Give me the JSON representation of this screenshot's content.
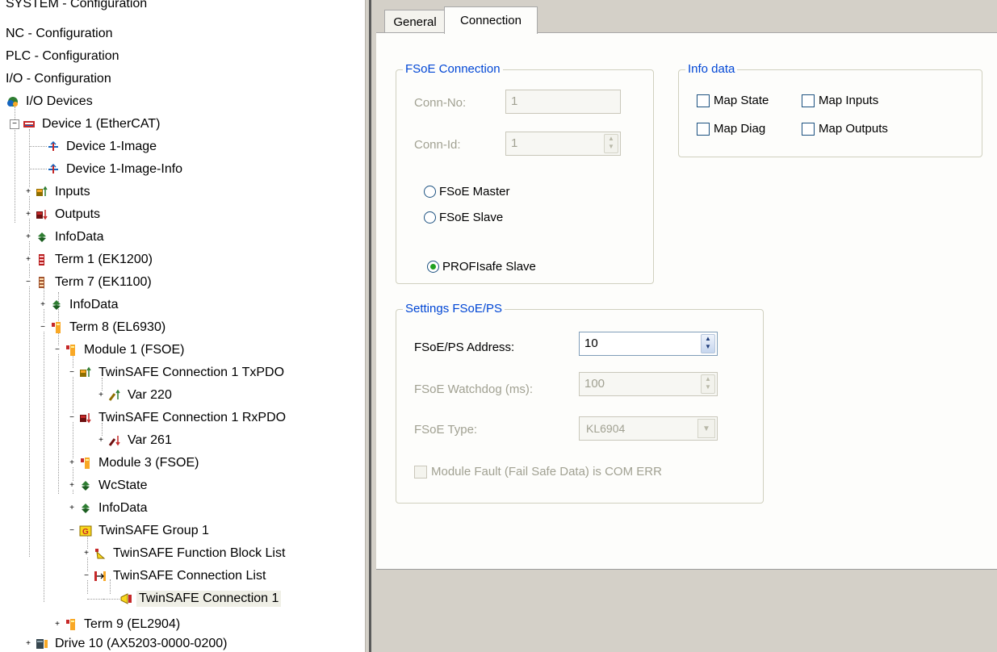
{
  "tree": {
    "nodes": [
      {
        "label": "SYSTEM - Configuration",
        "icon": "config-icon"
      },
      {
        "label": "NC - Configuration",
        "icon": ""
      },
      {
        "label": "PLC - Configuration",
        "icon": ""
      },
      {
        "label": "I/O - Configuration",
        "icon": ""
      },
      {
        "label": "I/O Devices",
        "icon": "io-devices-icon"
      },
      {
        "label": "Device 1 (EtherCAT)",
        "icon": "ethercat-device-icon"
      },
      {
        "label": "Device 1-Image",
        "icon": "image-icon"
      },
      {
        "label": "Device 1-Image-Info",
        "icon": "image-info-icon"
      },
      {
        "label": "Inputs",
        "icon": "inputs-icon"
      },
      {
        "label": "Outputs",
        "icon": "outputs-icon"
      },
      {
        "label": "InfoData",
        "icon": "infodata-icon"
      },
      {
        "label": "Term 1 (EK1200)",
        "icon": "terminal-icon"
      },
      {
        "label": "Term 7 (EK1100)",
        "icon": "terminal-icon"
      },
      {
        "label": "InfoData",
        "icon": "infodata-icon"
      },
      {
        "label": "Term 8 (EL6930)",
        "icon": "terminal-icon"
      },
      {
        "label": "Module 1 (FSOE)",
        "icon": "module-icon"
      },
      {
        "label": "TwinSAFE Connection 1 TxPDO",
        "icon": "txpdo-icon"
      },
      {
        "label": "Var 220",
        "icon": "var-input-icon"
      },
      {
        "label": "TwinSAFE Connection 1 RxPDO",
        "icon": "rxpdo-icon"
      },
      {
        "label": "Var 261",
        "icon": "var-output-icon"
      },
      {
        "label": "Module 3 (FSOE)",
        "icon": "module-icon"
      },
      {
        "label": "WcState",
        "icon": "wcstate-icon"
      },
      {
        "label": "InfoData",
        "icon": "infodata-icon"
      },
      {
        "label": "TwinSAFE Group 1",
        "icon": "group-icon"
      },
      {
        "label": "TwinSAFE Function Block List",
        "icon": "function-block-list-icon"
      },
      {
        "label": "TwinSAFE Connection List",
        "icon": "connection-list-icon"
      },
      {
        "label": "TwinSAFE Connection 1",
        "icon": "connection-icon"
      },
      {
        "label": "Term 9 (EL2904)",
        "icon": "terminal-icon"
      },
      {
        "label": "Drive 10 (AX5203-0000-0200)",
        "icon": "drive-icon"
      }
    ],
    "selected": "TwinSAFE Connection 1"
  },
  "tabs": [
    {
      "label": "General",
      "active": false
    },
    {
      "label": "Connection",
      "active": true
    }
  ],
  "fsoe_connection": {
    "legend": "FSoE Connection",
    "conn_no_label": "Conn-No:",
    "conn_no_value": "1",
    "conn_id_label": "Conn-Id:",
    "conn_id_value": "1",
    "radio_master": "FSoE Master",
    "radio_slave": "FSoE Slave",
    "radio_profisafe": "PROFIsafe Slave",
    "selected": "PROFIsafe Slave"
  },
  "info_data": {
    "legend": "Info data",
    "map_state": "Map State",
    "map_inputs": "Map Inputs",
    "map_diag": "Map Diag",
    "map_outputs": "Map Outputs"
  },
  "settings": {
    "legend": "Settings FSoE/PS",
    "address_label": "FSoE/PS Address:",
    "address_value": "10",
    "watchdog_label": "FSoE Watchdog (ms):",
    "watchdog_value": "100",
    "type_label": "FSoE Type:",
    "type_value": "KL6904",
    "module_fault_label": "Module Fault (Fail Safe Data) is COM ERR"
  },
  "colors": {
    "legend_blue": "#0046d5",
    "disabled_text": "#a1a192",
    "panel_gray": "#d4d0c8"
  }
}
